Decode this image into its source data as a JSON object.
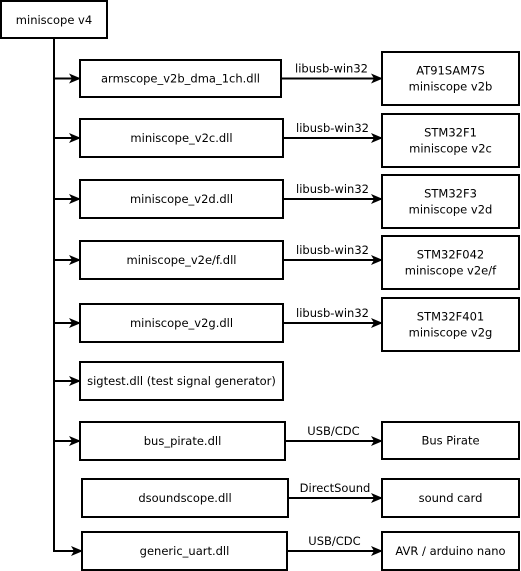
{
  "root": {
    "label": "miniscope v4"
  },
  "rows": [
    {
      "dll": "armscope_v2b_dma_1ch.dll",
      "link": "libusb-win32",
      "target": [
        "AT91SAM7S",
        "miniscope v2b"
      ],
      "from_root": true
    },
    {
      "dll": "miniscope_v2c.dll",
      "link": "libusb-win32",
      "target": [
        "STM32F1",
        "miniscope v2c"
      ],
      "from_root": true
    },
    {
      "dll": "miniscope_v2d.dll",
      "link": "libusb-win32",
      "target": [
        "STM32F3",
        "miniscope v2d"
      ],
      "from_root": true
    },
    {
      "dll": "miniscope_v2e/f.dll",
      "link": "libusb-win32",
      "target": [
        "STM32F042",
        "miniscope v2e/f"
      ],
      "from_root": true
    },
    {
      "dll": "miniscope_v2g.dll",
      "link": "libusb-win32",
      "target": [
        "STM32F401",
        "miniscope v2g"
      ],
      "from_root": true
    },
    {
      "dll": "sigtest.dll (test signal generator)",
      "link": "",
      "target": [],
      "from_root": true
    },
    {
      "dll": "bus_pirate.dll",
      "link": "USB/CDC",
      "target": [
        "Bus Pirate"
      ],
      "from_root": true
    },
    {
      "dll": "dsoundscope.dll",
      "link": "DirectSound",
      "target": [
        "sound card"
      ],
      "from_root": false
    },
    {
      "dll": "generic_uart.dll",
      "link": "USB/CDC",
      "target": [
        "AVR / arduino nano"
      ],
      "from_root": true
    }
  ]
}
